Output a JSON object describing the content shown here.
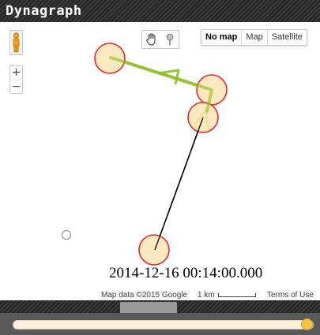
{
  "app": {
    "title": "Dynagraph"
  },
  "map": {
    "controls": {
      "zoom_in_label": "+",
      "zoom_out_label": "−",
      "map_types": [
        "No map",
        "Map",
        "Satellite"
      ],
      "selected_map_type": "No map"
    },
    "timestamp": "2014-12-16 00:14:00.000",
    "attribution": {
      "map_data": "Map data ©2015 Google",
      "scale_label": "1 km",
      "terms": "Terms of Use"
    },
    "colors": {
      "marker_fill": "#fde5b4",
      "marker_stroke": "#e8282a",
      "trail_color": "#8fbf2a",
      "path_color": "#000000"
    }
  },
  "timeline": {
    "position": 1.0
  }
}
